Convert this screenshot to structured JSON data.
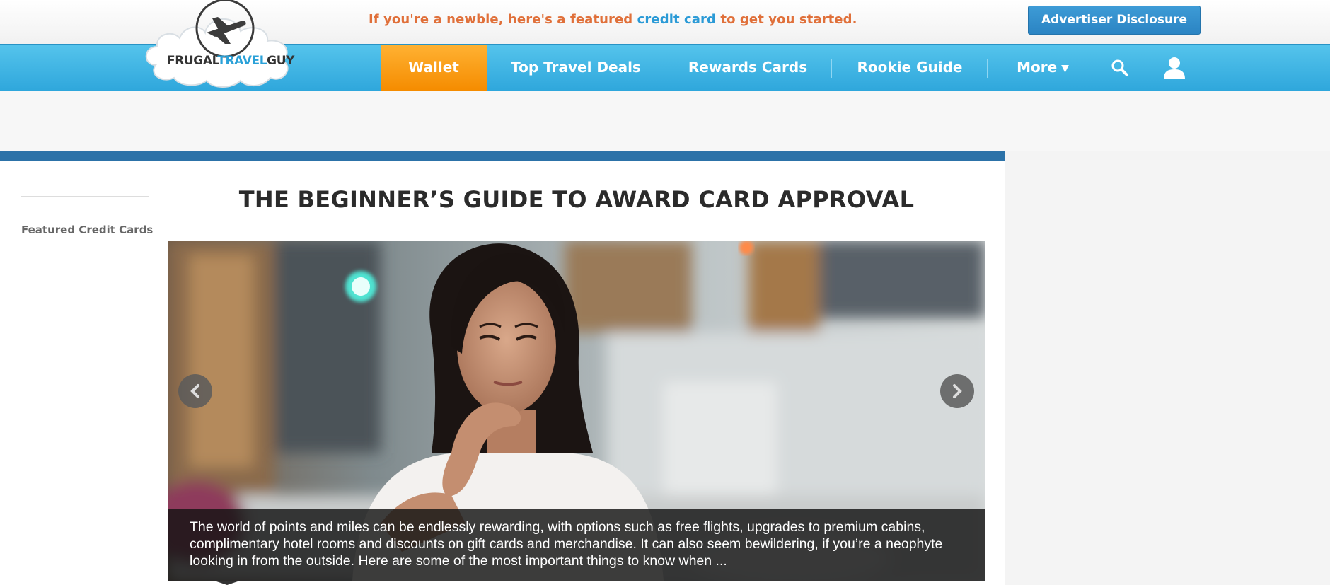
{
  "promo": {
    "prefix": "If you're a newbie, here's a featured ",
    "link_text": "credit card",
    "suffix": " to get you started."
  },
  "advertiser_button": "Advertiser Disclosure",
  "logo": {
    "part1": "FRUGAL",
    "part2": "TRAVEL",
    "part3": "GUY"
  },
  "nav": {
    "items": [
      {
        "label": "Wallet",
        "active": true
      },
      {
        "label": "Top Travel Deals"
      },
      {
        "label": "Rewards Cards"
      },
      {
        "label": "Rookie Guide"
      },
      {
        "label": "More",
        "caret": "▼"
      }
    ],
    "search_icon": "search-icon",
    "user_icon": "user-icon"
  },
  "sidebar": {
    "heading": "Featured Credit Cards"
  },
  "article": {
    "title": "THE BEGINNER’S GUIDE TO AWARD CARD APPROVAL",
    "excerpt": "The world of points and miles can be endlessly rewarding, with options such as free flights, upgrades to premium cabins, complimentary hotel rooms and discounts on gift cards and merchandise. It can also seem bewildering, if you’re a neophyte looking in from the outside. Here are some of the most important things to know when ..."
  },
  "colors": {
    "accent_orange": "#f58c00",
    "nav_blue": "#3bb1e2",
    "rule_blue": "#2c72a8",
    "promo_orange": "#e0703a",
    "link_blue": "#2a9ad6"
  }
}
